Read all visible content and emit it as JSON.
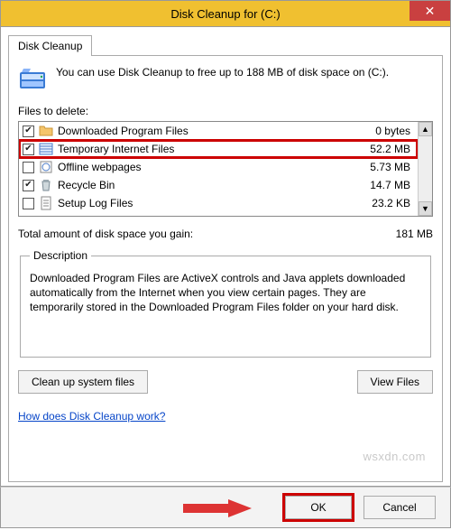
{
  "title": "Disk Cleanup for  (C:)",
  "close": "✕",
  "tab": "Disk Cleanup",
  "intro": "You can use Disk Cleanup to free up to 188 MB of disk space on  (C:).",
  "files_label": "Files to delete:",
  "rows": [
    {
      "checked": true,
      "name": "Downloaded Program Files",
      "size": "0 bytes"
    },
    {
      "checked": true,
      "name": "Temporary Internet Files",
      "size": "52.2 MB"
    },
    {
      "checked": false,
      "name": "Offline webpages",
      "size": "5.73 MB"
    },
    {
      "checked": true,
      "name": "Recycle Bin",
      "size": "14.7 MB"
    },
    {
      "checked": false,
      "name": "Setup Log Files",
      "size": "23.2 KB"
    }
  ],
  "total_label": "Total amount of disk space you gain:",
  "total_value": "181 MB",
  "desc_legend": "Description",
  "desc_text": "Downloaded Program Files are ActiveX controls and Java applets downloaded automatically from the Internet when you view certain pages. They are temporarily stored in the Downloaded Program Files folder on your hard disk.",
  "btn_cleanup": "Clean up system files",
  "btn_view": "View Files",
  "help_link": "How does Disk Cleanup work?",
  "btn_ok": "OK",
  "btn_cancel": "Cancel",
  "watermark": "wsxdn.com"
}
